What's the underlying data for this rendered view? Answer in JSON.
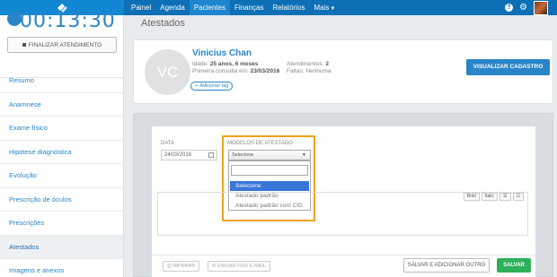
{
  "timer": {
    "value": "00:13:30",
    "finalize_label": "FINALIZAR ATENDIMENTO"
  },
  "nav": {
    "items": [
      {
        "label": "Painel"
      },
      {
        "label": "Agenda"
      },
      {
        "label": "Pacientes"
      },
      {
        "label": "Finanças"
      },
      {
        "label": "Relatórios"
      },
      {
        "label": "Mais"
      }
    ],
    "active": "Pacientes",
    "help_label": "?"
  },
  "sidebar": {
    "items": [
      {
        "label": "Resumo"
      },
      {
        "label": "Anamnese"
      },
      {
        "label": "Exame físico"
      },
      {
        "label": "Hipótese diagnóstica"
      },
      {
        "label": "Evolução"
      },
      {
        "label": "Prescrição de óculos"
      },
      {
        "label": "Prescrições"
      },
      {
        "label": "Atestados"
      },
      {
        "label": "Imagens e anexos"
      }
    ],
    "active": "Atestados"
  },
  "page": {
    "title": "Atestados"
  },
  "patient": {
    "initials": "VC",
    "name": "Vinicius Chan",
    "age_label": "Idade:",
    "age_value": "25 anos, 6 meses",
    "appointments_label": "Atendimentos:",
    "appointments_value": "2",
    "first_visit_label": "Primeira consulta em:",
    "first_visit_value": "23/03/2016",
    "absences_label": "Faltas:",
    "absences_value": "Nenhuma",
    "add_tag_label": "Adicionar tag",
    "view_record_label": "VISUALIZAR CADASTRO"
  },
  "form": {
    "date_label": "DATA",
    "date_value": "24/03/2016",
    "template_label": "MODELOS DE ATESTADO",
    "select_value": "Selecione",
    "dropdown_search": "",
    "options": [
      {
        "label": "Selecione",
        "selected": true
      },
      {
        "label": "Atestado padrão",
        "selected": false
      },
      {
        "label": "Atestado padrão com CID",
        "selected": false
      }
    ],
    "editor_tools": [
      {
        "label": "Bold"
      },
      {
        "label": "Italic"
      },
      {
        "label": "ul-list"
      },
      {
        "label": "ol-list"
      }
    ],
    "print_label": "IMPRIMIR",
    "email_label": "ENVIAR POR E-MAIL",
    "save_add_label": "SALVAR E ADICIONAR OUTRO",
    "save_label": "SALVAR"
  },
  "colors": {
    "primary": "#2a85c8",
    "nav": "#0d6fb5",
    "highlight": "#f0a21c",
    "save": "#2eb05a",
    "selected": "#3875d7"
  }
}
